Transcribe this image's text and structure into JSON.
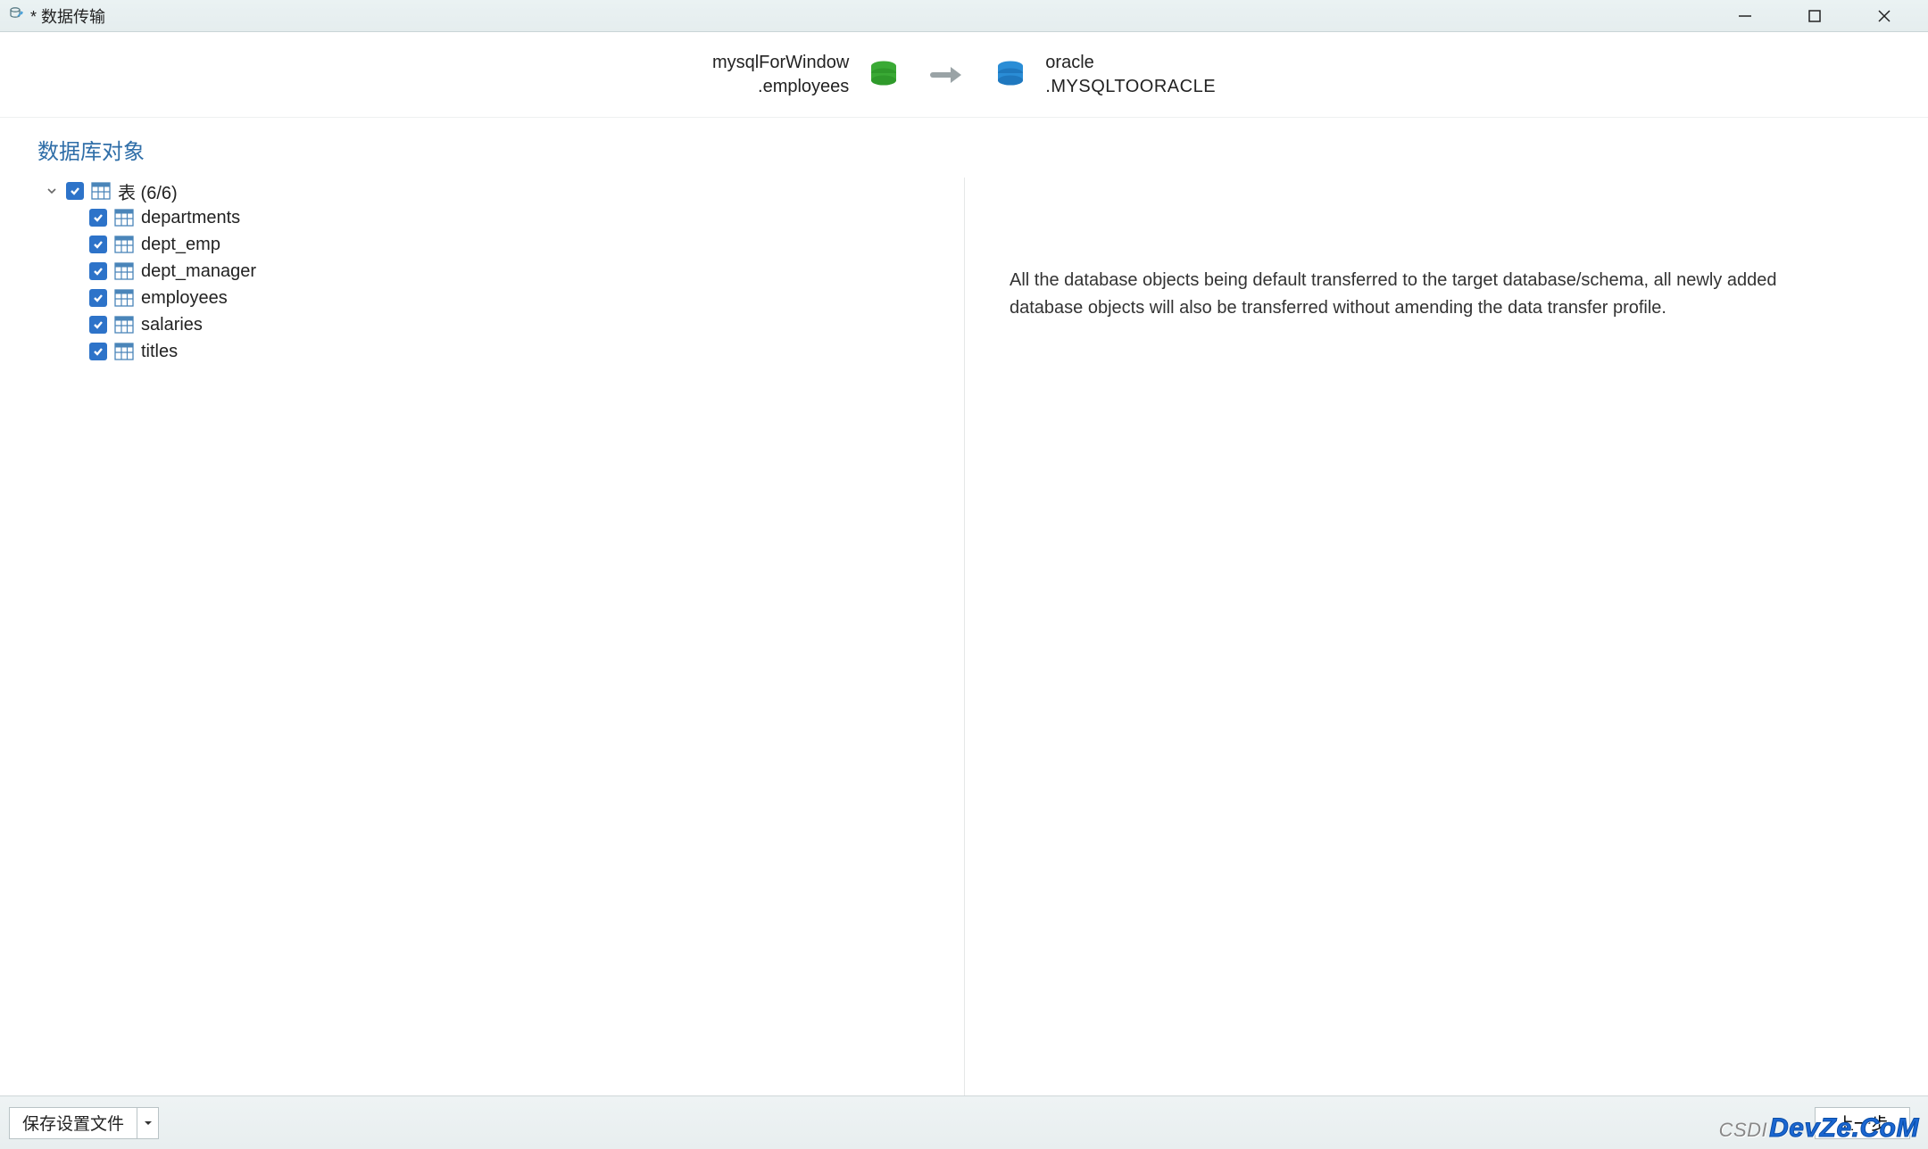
{
  "titlebar": {
    "title": "* 数据传输"
  },
  "connection": {
    "source": {
      "line1": "mysqlForWindow",
      "line2": ".employees"
    },
    "target": {
      "line1": "oracle",
      "line2": ".MYSQLTOORACLE"
    }
  },
  "section": {
    "title": "数据库对象"
  },
  "tree": {
    "parent_label": "表  (6/6)",
    "items": [
      {
        "label": "departments"
      },
      {
        "label": "dept_emp"
      },
      {
        "label": "dept_manager"
      },
      {
        "label": "employees"
      },
      {
        "label": "salaries"
      },
      {
        "label": "titles"
      }
    ]
  },
  "info": {
    "text": "All the database objects being default transferred to the target database/schema, all newly added database objects will also be transferred without amending the data transfer profile."
  },
  "footer": {
    "save_profile": "保存设置文件",
    "prev": "上一步"
  },
  "watermark": {
    "prefix": "CSDI",
    "main": "DevZe.CoM"
  },
  "icons": {
    "app": "db-app-icon",
    "source_db": "mysql-db-icon",
    "target_db": "oracle-db-icon",
    "arrow": "transfer-arrow-icon"
  }
}
